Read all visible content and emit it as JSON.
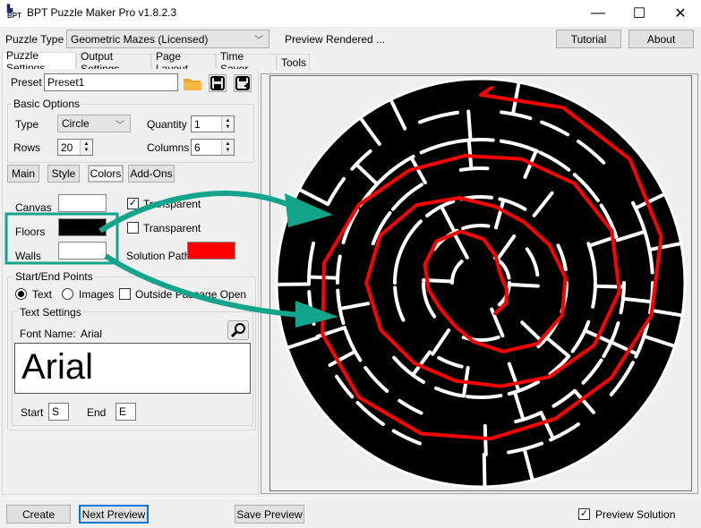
{
  "window": {
    "title": "BPT Puzzle Maker Pro v1.8.2.3",
    "icon": "bpt-logo-icon",
    "minimize_icon": "—",
    "maximize_icon": "☐",
    "close_icon": "✕"
  },
  "header": {
    "puzzle_type_label": "Puzzle Type",
    "puzzle_type_value": "Geometric Mazes (Licensed)",
    "status": "Preview Rendered ...",
    "tutorial_label": "Tutorial",
    "about_label": "About"
  },
  "tabs": [
    {
      "label": "Puzzle Settings",
      "active": true
    },
    {
      "label": "Output Settings"
    },
    {
      "label": "Page Layout"
    },
    {
      "label": "Time Saver"
    },
    {
      "label": "Tools"
    }
  ],
  "preset": {
    "label": "Preset",
    "value": "Preset1"
  },
  "basic_options": {
    "title": "Basic Options",
    "type_label": "Type",
    "type_value": "Circle",
    "quantity_label": "Quantity",
    "quantity_value": "1",
    "rows_label": "Rows",
    "rows_value": "20",
    "columns_label": "Columns",
    "columns_value": "6"
  },
  "subtabs": [
    "Main",
    "Style",
    "Colors",
    "Add-Ons"
  ],
  "colors": {
    "canvas_label": "Canvas",
    "canvas_color": "#ffffff",
    "floors_label": "Floors",
    "floors_color": "#000000",
    "walls_label": "Walls",
    "walls_color": "#ffffff",
    "transparent1_label": "Transparent",
    "transparent1_checked": true,
    "transparent2_label": "Transparent",
    "transparent2_checked": false,
    "solution_path_label": "Solution Path",
    "solution_path_color": "#ff0000"
  },
  "start_end": {
    "title": "Start/End Points",
    "text_label": "Text",
    "images_label": "Images",
    "outside_label": "Outside Passage Open",
    "text_settings_title": "Text Settings",
    "font_name_label": "Font Name:",
    "font_name_value": "Arial",
    "font_preview": "Arial",
    "start_label": "Start",
    "start_value": "S",
    "end_label": "End",
    "end_value": "E"
  },
  "footer": {
    "create_label": "Create",
    "next_preview_label": "Next Preview",
    "save_preview_label": "Save Preview",
    "preview_solution_label": "Preview Solution",
    "preview_solution_checked": true
  },
  "annotation_color": "#13a58b",
  "maze_colors": {
    "floor": "#000000",
    "wall": "#ffffff",
    "path": "#ff0000"
  }
}
